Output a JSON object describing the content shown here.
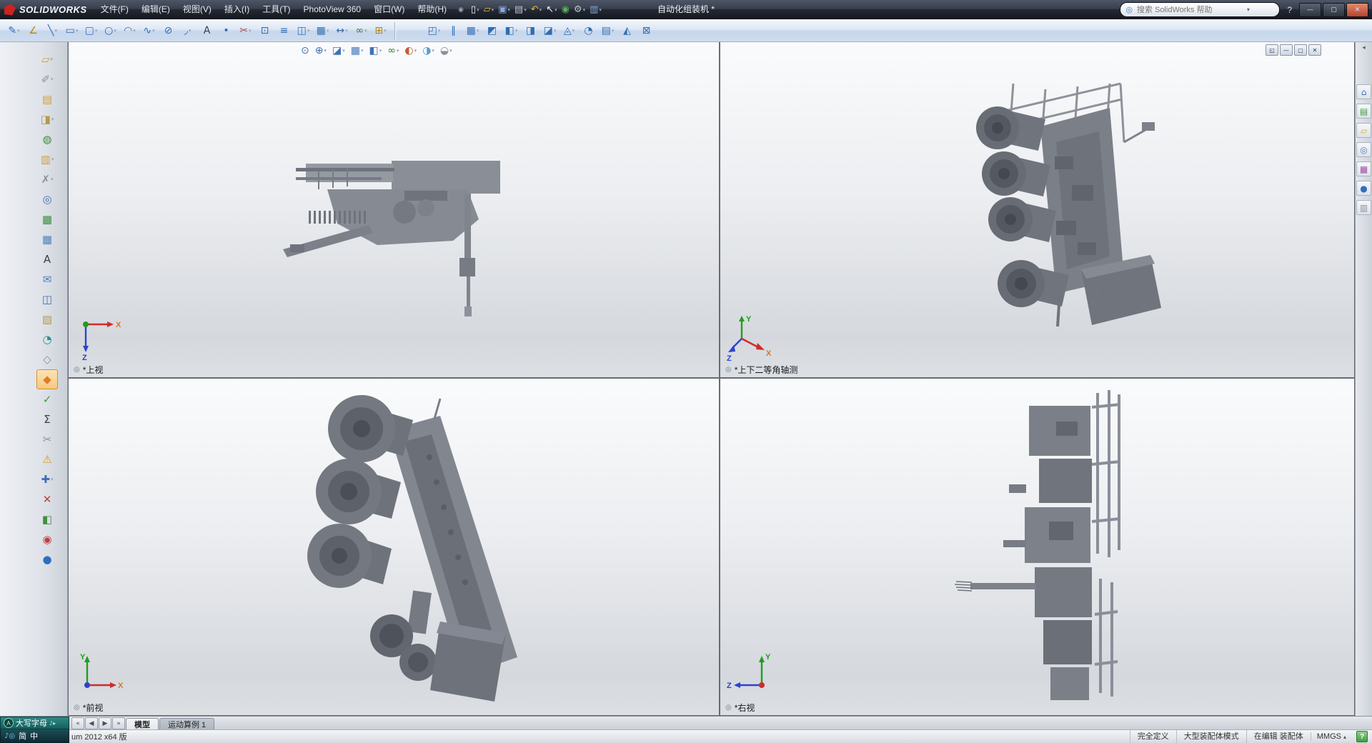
{
  "titlebar": {
    "brand": "SOLIDWORKS",
    "menus": [
      "文件(F)",
      "编辑(E)",
      "视图(V)",
      "插入(I)",
      "工具(T)",
      "PhotoView 360",
      "窗口(W)",
      "帮助(H)"
    ],
    "pin_glyph": "◉",
    "quick_tools": [
      {
        "name": "new-document-icon",
        "glyph": "▯",
        "color": "#eef2f8",
        "dd": "▾"
      },
      {
        "name": "open-icon",
        "glyph": "▱",
        "color": "#e3b34f",
        "dd": "▾"
      },
      {
        "name": "save-icon",
        "glyph": "▣",
        "color": "#86a9d8",
        "dd": "▾"
      },
      {
        "name": "print-icon",
        "glyph": "▤",
        "color": "#b9c2cf",
        "dd": "▾"
      },
      {
        "name": "undo-icon",
        "glyph": "↶",
        "color": "#e8b23a",
        "dd": "▾"
      },
      {
        "name": "select-icon",
        "glyph": "↖",
        "color": "#eef2f8",
        "dd": "▾"
      },
      {
        "name": "rebuild-icon",
        "glyph": "◉",
        "color": "#58b158",
        "dd": ""
      },
      {
        "name": "options-icon",
        "glyph": "⚙",
        "color": "#b9c2cf",
        "dd": "▾"
      },
      {
        "name": "file-properties-icon",
        "glyph": "▥",
        "color": "#86a9d8",
        "dd": "▾"
      }
    ],
    "title": "自动化组装机 *",
    "search_placeholder": "搜索 SolidWorks 帮助",
    "search_icon_glyph": "◎",
    "search_dd_glyph": "▾",
    "help_glyph": "?",
    "window_controls": [
      {
        "name": "minimize-button",
        "glyph": "—"
      },
      {
        "name": "maximize-button",
        "glyph": "▢"
      },
      {
        "name": "close-button",
        "glyph": "✕"
      }
    ]
  },
  "toolbar": {
    "sketch_tools": [
      {
        "name": "sketch-icon",
        "glyph": "✎",
        "color": "#2f6cb5",
        "dd": "▾"
      },
      {
        "name": "smart-dimension-icon",
        "glyph": "∠",
        "color": "#b8860b",
        "dd": ""
      },
      {
        "name": "line-icon",
        "glyph": "╲",
        "color": "#2f6cb5",
        "dd": "▾"
      },
      {
        "name": "rectangle-icon",
        "glyph": "▭",
        "color": "#2f6cb5",
        "dd": "▾"
      },
      {
        "name": "slot-icon",
        "glyph": "▢",
        "color": "#2f6cb5",
        "dd": "▾"
      },
      {
        "name": "circle-icon",
        "glyph": "○",
        "color": "#2f6cb5",
        "dd": "▾"
      },
      {
        "name": "arc-icon",
        "glyph": "◠",
        "color": "#2f6cb5",
        "dd": "▾"
      },
      {
        "name": "spline-icon",
        "glyph": "∿",
        "color": "#2f6cb5",
        "dd": "▾"
      },
      {
        "name": "ellipse-icon",
        "glyph": "⊘",
        "color": "#2f6cb5",
        "dd": ""
      },
      {
        "name": "sketch-fillet-icon",
        "glyph": "◞",
        "color": "#2f6cb5",
        "dd": "▾"
      },
      {
        "name": "text-icon",
        "glyph": "A",
        "color": "#38404c",
        "dd": ""
      },
      {
        "name": "point-icon",
        "glyph": "•",
        "color": "#2f6cb5",
        "dd": ""
      },
      {
        "name": "trim-entities-icon",
        "glyph": "✂",
        "color": "#a84848",
        "dd": "▾"
      },
      {
        "name": "convert-entities-icon",
        "glyph": "⊡",
        "color": "#2f6cb5",
        "dd": ""
      },
      {
        "name": "offset-entities-icon",
        "glyph": "≡",
        "color": "#2f6cb5",
        "dd": ""
      },
      {
        "name": "mirror-entities-icon",
        "glyph": "◫",
        "color": "#2f6cb5",
        "dd": "▾"
      },
      {
        "name": "linear-sketch-pattern-icon",
        "glyph": "▦",
        "color": "#2f6cb5",
        "dd": "▾"
      },
      {
        "name": "move-entities-icon",
        "glyph": "↔",
        "color": "#2f6cb5",
        "dd": "▾"
      },
      {
        "name": "display-relations-icon",
        "glyph": "∞",
        "color": "#3f7a3f",
        "dd": "▾"
      },
      {
        "name": "quick-snaps-icon",
        "glyph": "⊞",
        "color": "#b8860b",
        "dd": "▾"
      }
    ],
    "assembly_tools": [
      {
        "name": "insert-components-icon",
        "glyph": "◰",
        "color": "#2f6cb5",
        "dd": "▾"
      },
      {
        "name": "mate-icon",
        "glyph": "∥",
        "color": "#2f6cb5",
        "dd": ""
      },
      {
        "name": "linear-component-pattern-icon",
        "glyph": "▦",
        "color": "#2f6cb5",
        "dd": "▾"
      },
      {
        "name": "smart-fasteners-icon",
        "glyph": "◩",
        "color": "#2f6cb5",
        "dd": ""
      },
      {
        "name": "move-component-icon",
        "glyph": "◧",
        "color": "#2f6cb5",
        "dd": "▾"
      },
      {
        "name": "show-hidden-components-icon",
        "glyph": "◨",
        "color": "#2f6cb5",
        "dd": ""
      },
      {
        "name": "assembly-features-icon",
        "glyph": "◪",
        "color": "#2f6cb5",
        "dd": "▾"
      },
      {
        "name": "reference-geometry-icon",
        "glyph": "◬",
        "color": "#2f6cb5",
        "dd": "▾"
      },
      {
        "name": "new-motion-study-icon",
        "glyph": "◔",
        "color": "#2f6cb5",
        "dd": ""
      },
      {
        "name": "bill-of-materials-icon",
        "glyph": "▤",
        "color": "#2f6cb5",
        "dd": "▾"
      },
      {
        "name": "exploded-view-icon",
        "glyph": "◭",
        "color": "#2f6cb5",
        "dd": ""
      },
      {
        "name": "large-assembly-mode-icon",
        "glyph": "⊠",
        "color": "#2f6cb5",
        "dd": ""
      }
    ]
  },
  "left_toolbar": {
    "tools": [
      {
        "name": "left-tool-1-icon",
        "glyph": "▱",
        "color": "#cf9f3a",
        "dd": "▾"
      },
      {
        "name": "left-tool-2-icon",
        "glyph": "✐",
        "color": "#8a909a",
        "dd": "▾"
      },
      {
        "name": "left-tool-3-icon",
        "glyph": "▤",
        "color": "#cf9f3a",
        "dd": ""
      },
      {
        "name": "left-tool-4-icon",
        "glyph": "◨",
        "color": "#b59950",
        "dd": "▾"
      },
      {
        "name": "left-tool-5-icon",
        "glyph": "◍",
        "color": "#3f8f3f",
        "dd": ""
      },
      {
        "name": "left-tool-6-icon",
        "glyph": "▥",
        "color": "#cf9f3a",
        "dd": "▾"
      },
      {
        "name": "left-tool-7-icon",
        "glyph": "✗",
        "color": "#8a909a",
        "dd": "▾"
      },
      {
        "name": "left-tool-8-icon",
        "glyph": "◎",
        "color": "#3f6fb5",
        "dd": ""
      },
      {
        "name": "left-tool-9-icon",
        "glyph": "▩",
        "color": "#3f8f3f",
        "dd": ""
      },
      {
        "name": "left-tool-10-icon",
        "glyph": "▦",
        "color": "#4f7fc0",
        "dd": ""
      },
      {
        "name": "left-tool-11-icon",
        "glyph": "A",
        "color": "#38404c",
        "dd": ""
      },
      {
        "name": "left-tool-12-icon",
        "glyph": "✉",
        "color": "#4f7fc0",
        "dd": ""
      },
      {
        "name": "left-tool-13-icon",
        "glyph": "◫",
        "color": "#3f6fb5",
        "dd": ""
      },
      {
        "name": "left-tool-14-icon",
        "glyph": "▨",
        "color": "#b59950",
        "dd": ""
      },
      {
        "name": "left-tool-15-icon",
        "glyph": "◔",
        "color": "#2f8f8f",
        "dd": ""
      },
      {
        "name": "left-tool-16-icon",
        "glyph": "◇",
        "color": "#8a909a",
        "dd": ""
      },
      {
        "name": "left-tool-17-icon",
        "glyph": "◆",
        "color": "#e07b2a",
        "dd": "",
        "sel": "1"
      },
      {
        "name": "left-tool-18-icon",
        "glyph": "✓",
        "color": "#3f9e3f",
        "dd": ""
      },
      {
        "name": "left-tool-19-icon",
        "glyph": "Σ",
        "color": "#38404c",
        "dd": ""
      },
      {
        "name": "left-tool-20-icon",
        "glyph": "✂",
        "color": "#8a909a",
        "dd": ""
      },
      {
        "name": "left-tool-21-icon",
        "glyph": "⚠",
        "color": "#d99a21",
        "dd": ""
      },
      {
        "name": "left-tool-22-icon",
        "glyph": "✚",
        "color": "#3f6fb5",
        "dd": "▾"
      },
      {
        "name": "left-tool-23-icon",
        "glyph": "✕",
        "color": "#c04040",
        "dd": ""
      },
      {
        "name": "left-tool-24-icon",
        "glyph": "◧",
        "color": "#3f8f3f",
        "dd": ""
      },
      {
        "name": "left-tool-25-icon",
        "glyph": "◉",
        "color": "#c04040",
        "dd": ""
      },
      {
        "name": "left-tool-26-icon",
        "glyph": "●",
        "color": "#2e6fbd",
        "dd": ""
      }
    ]
  },
  "task_pane": {
    "collapse_glyph": "◂",
    "tabs": [
      {
        "name": "resources-icon",
        "glyph": "⌂",
        "color": "#3f72b8"
      },
      {
        "name": "design-library-icon",
        "glyph": "▤",
        "color": "#3f9e3f"
      },
      {
        "name": "file-explorer-icon",
        "glyph": "▱",
        "color": "#d8a93c"
      },
      {
        "name": "search-icon",
        "glyph": "◎",
        "color": "#4f7fc0"
      },
      {
        "name": "view-palette-icon",
        "glyph": "▦",
        "color": "#a050a0"
      },
      {
        "name": "appearances-scenes-icon",
        "glyph": "●",
        "color": "#2e6fbd"
      },
      {
        "name": "custom-properties-icon",
        "glyph": "▥",
        "color": "#8a909a"
      }
    ]
  },
  "graphics": {
    "headsup_tools": [
      {
        "name": "zoom-fit-icon",
        "glyph": "⊙",
        "color": "#3f72b8",
        "dd": ""
      },
      {
        "name": "zoom-area-icon",
        "glyph": "⊕",
        "color": "#3f72b8",
        "dd": "▾"
      },
      {
        "name": "section-view-icon",
        "glyph": "◪",
        "color": "#3f72b8",
        "dd": "▾"
      },
      {
        "name": "view-orientation-icon",
        "glyph": "▦",
        "color": "#3f72b8",
        "dd": "▾"
      },
      {
        "name": "display-style-icon",
        "glyph": "◧",
        "color": "#3f72b8",
        "dd": "▾"
      },
      {
        "name": "hide-show-items-icon",
        "glyph": "∞",
        "color": "#3f7a3f",
        "dd": "▾"
      },
      {
        "name": "edit-appearance-icon",
        "glyph": "◐",
        "color": "#c06030",
        "dd": "▾"
      },
      {
        "name": "apply-scene-icon",
        "glyph": "◑",
        "color": "#58a0d0",
        "dd": "▾"
      },
      {
        "name": "view-settings-icon",
        "glyph": "◒",
        "color": "#8a909a",
        "dd": "▾"
      }
    ],
    "window_buttons": [
      {
        "name": "viewport-restore-button",
        "glyph": "◱"
      },
      {
        "name": "viewport-minimize-button",
        "glyph": "—"
      },
      {
        "name": "viewport-maximize-button",
        "glyph": "▢"
      },
      {
        "name": "viewport-close-button",
        "glyph": "✕"
      }
    ],
    "view_flag_glyph": "◎",
    "viewports": [
      {
        "label": "*上视",
        "triad": {
          "x": "X",
          "z": "Z"
        }
      },
      {
        "label": "*上下二等角轴测",
        "triad": {
          "x": "X",
          "y": "Y",
          "z": "Z"
        }
      },
      {
        "label": "*前视",
        "triad": {
          "x": "X",
          "y": "Y"
        }
      },
      {
        "label": "*右视",
        "triad": {
          "y": "Y",
          "z": "Z"
        }
      }
    ]
  },
  "tab_bar": {
    "nav": [
      "«",
      "◀",
      "▶",
      "»"
    ],
    "tabs": [
      {
        "label": "模型",
        "act": "1"
      },
      {
        "label": "运动算例 1",
        "act": "0"
      }
    ]
  },
  "status_bar": {
    "version_text": "um 2012 x64 版",
    "items": [
      "完全定义",
      "大型装配体模式",
      "在编辑 装配体"
    ],
    "units": "MMGS",
    "units_arrow": "▴",
    "help_glyph": "?"
  },
  "ime_bar": {
    "row1": {
      "icon_glyph": "A",
      "label": "大写字母",
      "extras": [
        "♪",
        "▸"
      ]
    },
    "row2": {
      "icons": [
        {
          "name": "speaker-icon",
          "glyph": "♪"
        },
        {
          "name": "ime-search-icon",
          "glyph": "◎"
        }
      ],
      "lang": "简",
      "mode": "中"
    }
  }
}
